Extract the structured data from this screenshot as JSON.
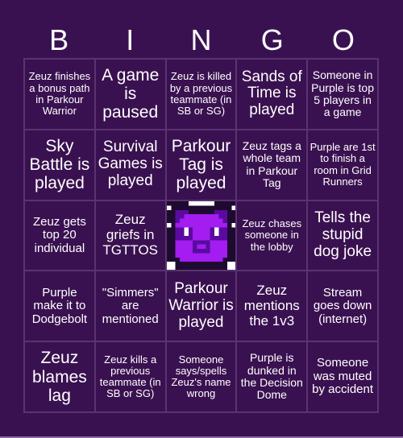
{
  "header": {
    "letters": [
      "B",
      "I",
      "N",
      "G",
      "O"
    ]
  },
  "colors": {
    "background": "#3a1150",
    "grid_line": "#5a3370",
    "text": "#ffffff",
    "free_icon_main": "#a31cf0",
    "free_icon_dark": "#5b0aa0"
  },
  "cells": [
    "Zeuz finishes a bonus path in Parkour Warrior",
    "A game is paused",
    "Zeuz is killed by a previous teammate (in SB or SG)",
    "Sands of Time is played",
    "Someone in Purple is top 5 players in a game",
    "Sky Battle is played",
    "Survival Games is played",
    "Parkour Tag is played",
    "Zeuz tags a whole team in Parkour Tag",
    "Purple are 1st to finish a room in Grid Runners",
    "Zeuz gets top 20 individual",
    "Zeuz griefs in TGTTOS",
    "",
    "Zeuz chases someone in the lobby",
    "Tells the stupid dog joke",
    "Purple make it to Dodgebolt",
    "\"Simmers\" are mentioned",
    "Parkour Warrior is played",
    "Zeuz mentions the 1v3",
    "Stream goes down (internet)",
    "Zeuz blames lag",
    "Zeuz kills a previous teammate (in SB or SG)",
    "Someone says/spells Zeuz's name wrong",
    "Purple is dunked in the Decision Dome",
    "Someone was muted by accident"
  ],
  "free_space": {
    "icon": "purple-panda-icon"
  }
}
